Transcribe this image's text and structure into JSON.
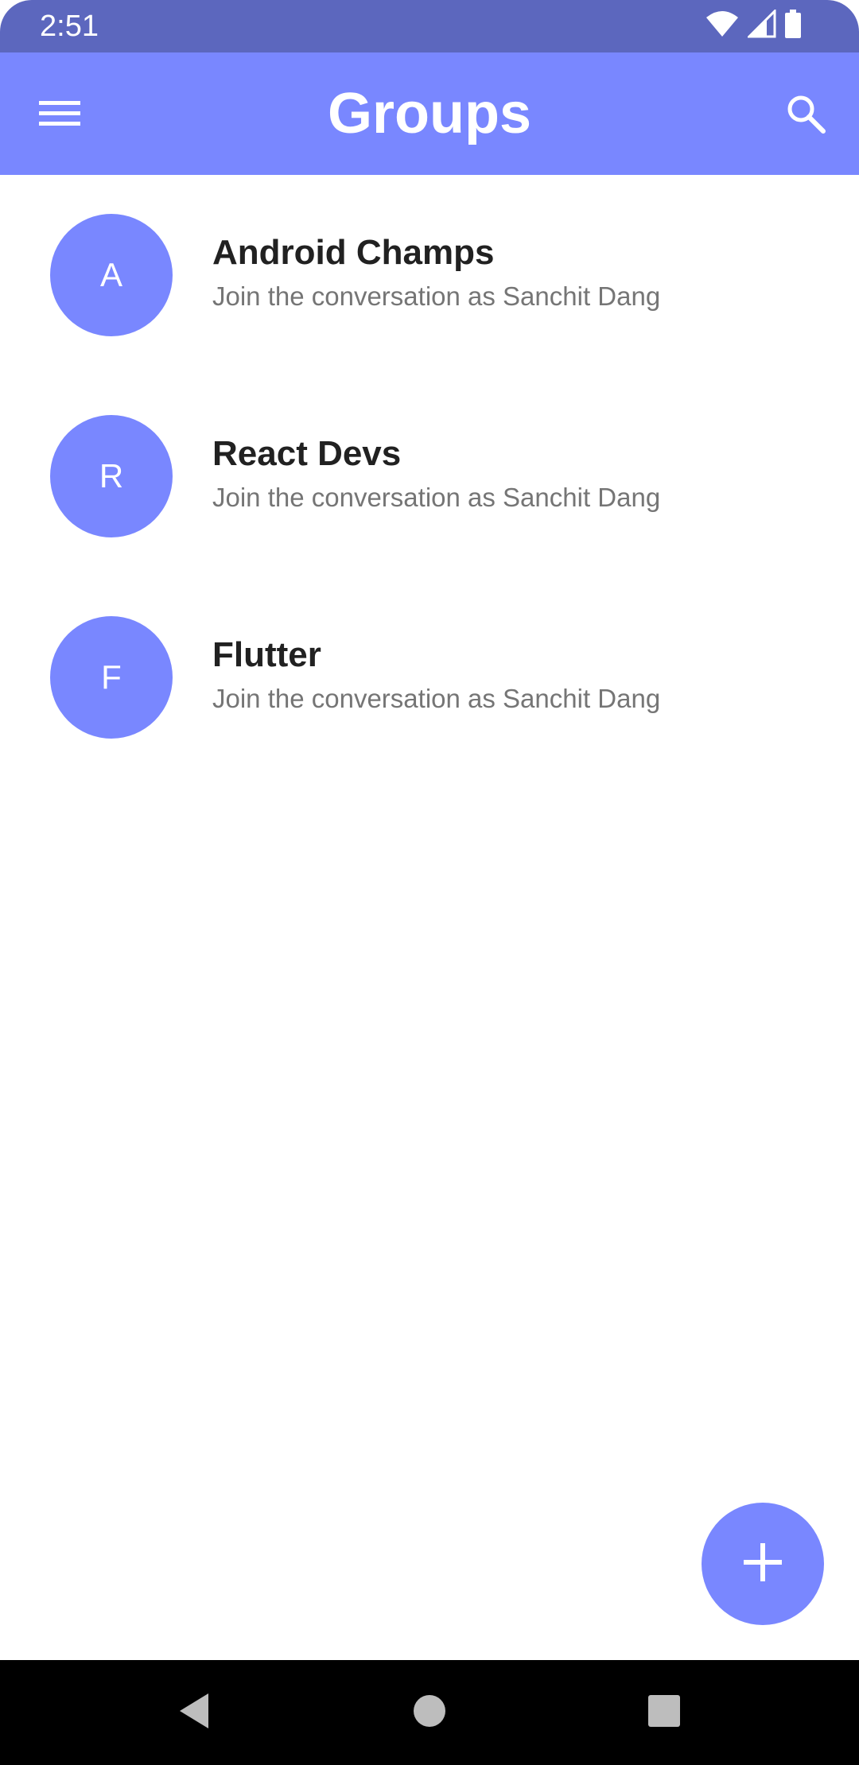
{
  "status_bar": {
    "time": "2:51",
    "icons": [
      "wifi-icon",
      "cell-signal-icon",
      "battery-icon"
    ]
  },
  "app_bar": {
    "title": "Groups",
    "menu_icon": "hamburger-menu-icon",
    "search_icon": "search-icon"
  },
  "groups": [
    {
      "initial": "A",
      "name": "Android Champs",
      "subtitle": "Join the conversation as Sanchit Dang"
    },
    {
      "initial": "R",
      "name": "React Devs",
      "subtitle": "Join the conversation as Sanchit Dang"
    },
    {
      "initial": "F",
      "name": "Flutter",
      "subtitle": "Join the conversation as Sanchit Dang"
    }
  ],
  "fab": {
    "icon": "plus-icon"
  },
  "nav_bar": {
    "icons": [
      "back-icon",
      "home-icon",
      "recents-icon"
    ]
  },
  "colors": {
    "status_bar": "#5c67be",
    "primary": "#7987ff",
    "title_text": "#212121",
    "subtitle_text": "#757575",
    "nav_bar": "#000000"
  }
}
